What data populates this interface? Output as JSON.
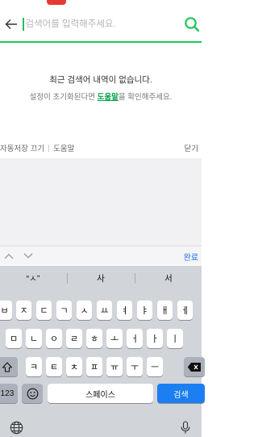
{
  "search": {
    "placeholder": "검색어를 입력해주세요.",
    "value": ""
  },
  "empty_state": {
    "title": "최근 검색어 내역이 없습니다.",
    "desc_before": "설정이 초기화된다면 ",
    "help_link": "도움말",
    "desc_after": "을 확인해주세요."
  },
  "autosave_bar": {
    "autosave_off": "자동저장 끄기",
    "help": "도움말",
    "close": "닫기"
  },
  "accessory": {
    "done": "완료"
  },
  "keyboard": {
    "suggestions": [
      "“ㅅ”",
      "사",
      "서"
    ],
    "row1": [
      "ㅂ",
      "ㅈ",
      "ㄷ",
      "ㄱ",
      "ㅅ",
      "ㅛ",
      "ㅕ",
      "ㅑ",
      "ㅐ",
      "ㅔ"
    ],
    "row2": [
      "ㅁ",
      "ㄴ",
      "ㅇ",
      "ㄹ",
      "ㅎ",
      "ㅗ",
      "ㅓ",
      "ㅏ",
      "ㅣ"
    ],
    "row3": [
      "ㅋ",
      "ㅌ",
      "ㅊ",
      "ㅍ",
      "ㅠ",
      "ㅜ",
      "ㅡ"
    ],
    "numbers_key": "123",
    "space_key": "스페이스",
    "search_key": "검색"
  },
  "colors": {
    "accent_green": "#1ec659",
    "link_green": "#0aa14f",
    "key_blue": "#1b7ef2"
  },
  "icons": {
    "back": "back-arrow-icon",
    "search": "search-icon",
    "shift": "shift-icon",
    "backspace": "backspace-icon",
    "emoji": "emoji-icon",
    "globe": "globe-icon",
    "mic": "microphone-icon"
  }
}
